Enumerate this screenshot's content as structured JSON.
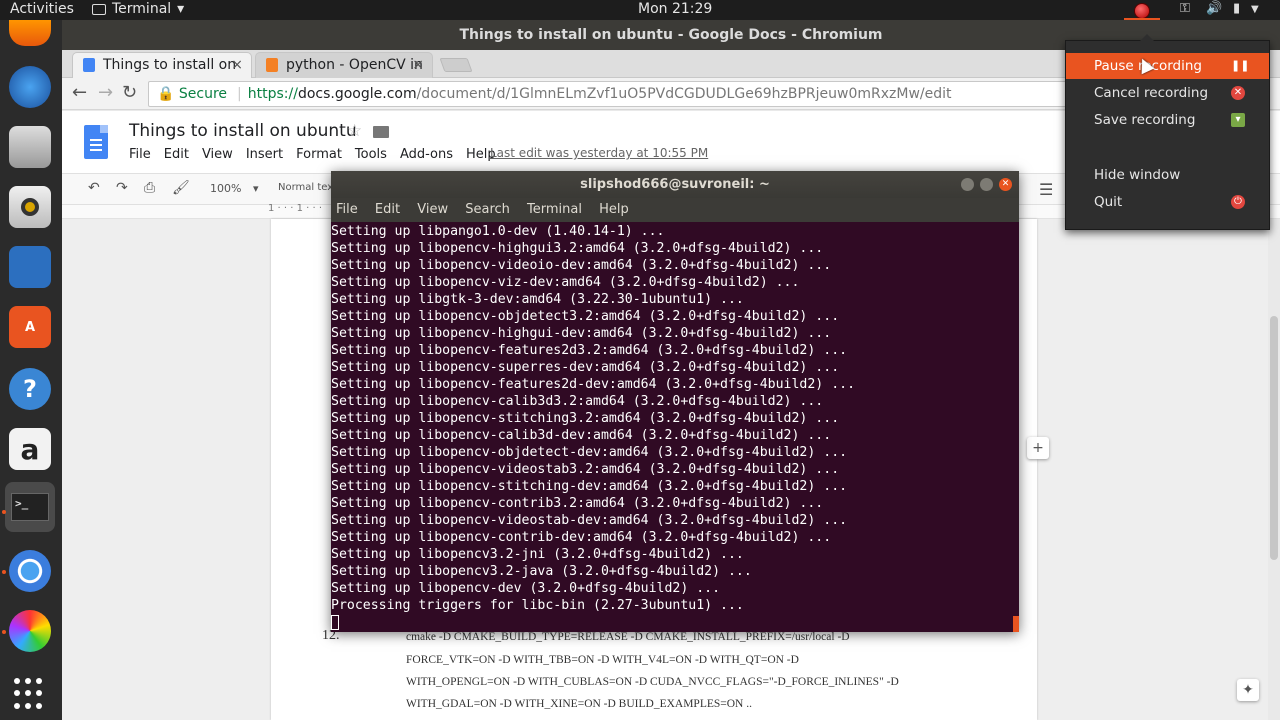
{
  "topbar": {
    "activities": "Activities",
    "app_name": "Terminal",
    "app_arrow": "▾",
    "clock": "Mon 21:29",
    "status_icons": [
      "recorder-icon",
      "network-icon",
      "volume-icon",
      "battery-icon",
      "power-menu-icon"
    ]
  },
  "window": {
    "title": "Things to install on ubuntu - Google Docs - Chromium"
  },
  "dock": {
    "items": [
      "firefox-icon",
      "thunderbird-icon",
      "files-icon",
      "rhythmbox-icon",
      "libreoffice-writer-icon",
      "software-center-icon",
      "help-icon",
      "amazon-icon",
      "terminal-icon",
      "chromium-icon",
      "color-app-icon"
    ],
    "show_apps": "show-applications-icon"
  },
  "browser": {
    "tabs": [
      {
        "title": "Things to install on",
        "close": "×",
        "favicon_color": "#4285f4"
      },
      {
        "title": "python - OpenCV in",
        "close": "×",
        "favicon_color": "#f48024"
      }
    ],
    "nav": {
      "back": "←",
      "forward": "→",
      "reload": "↻"
    },
    "omnibox": {
      "lock": "🔒",
      "secure": "Secure",
      "https": "https://",
      "host": "docs.google.com",
      "path": "/document/d/1GlmnELmZvf1uO5PVdCGDUDLGe69hzBPRjeuw0mRxzMw/edit"
    }
  },
  "docs": {
    "title": "Things to install on ubuntu",
    "star": "☆",
    "menus": [
      "File",
      "Edit",
      "View",
      "Insert",
      "Format",
      "Tools",
      "Add-ons",
      "Help"
    ],
    "last_edit": "Last edit was yesterday at 10:55 PM",
    "toolbar": {
      "undo": "↶",
      "redo": "↷",
      "print": "⎙",
      "paint": "🖌",
      "zoom": "100%",
      "zoom_arrow": "▾",
      "style": "Normal tex"
    },
    "ruler_mark": "1 · · · 1 · · ·",
    "list_number": "12.",
    "body_lines": [
      "cmake -D CMAKE_BUILD_TYPE=RELEASE -D CMAKE_INSTALL_PREFIX=/usr/local -D",
      "FORCE_VTK=ON -D WITH_TBB=ON -D WITH_V4L=ON -D WITH_QT=ON -D",
      "WITH_OPENGL=ON -D WITH_CUBLAS=ON -D CUDA_NVCC_FLAGS=\"-D_FORCE_INLINES\" -D",
      "WITH_GDAL=ON -D WITH_XINE=ON -D BUILD_EXAMPLES=ON .."
    ],
    "add_comment": "+",
    "explore": "✦"
  },
  "terminal": {
    "title": "slipshod666@suvroneil: ~",
    "close": "✕",
    "menu": [
      "File",
      "Edit",
      "View",
      "Search",
      "Terminal",
      "Help"
    ],
    "lines": [
      "Setting up libpango1.0-dev (1.40.14-1) ...",
      "Setting up libopencv-highgui3.2:amd64 (3.2.0+dfsg-4build2) ...",
      "Setting up libopencv-videoio-dev:amd64 (3.2.0+dfsg-4build2) ...",
      "Setting up libopencv-viz-dev:amd64 (3.2.0+dfsg-4build2) ...",
      "Setting up libgtk-3-dev:amd64 (3.22.30-1ubuntu1) ...",
      "Setting up libopencv-objdetect3.2:amd64 (3.2.0+dfsg-4build2) ...",
      "Setting up libopencv-highgui-dev:amd64 (3.2.0+dfsg-4build2) ...",
      "Setting up libopencv-features2d3.2:amd64 (3.2.0+dfsg-4build2) ...",
      "Setting up libopencv-superres-dev:amd64 (3.2.0+dfsg-4build2) ...",
      "Setting up libopencv-features2d-dev:amd64 (3.2.0+dfsg-4build2) ...",
      "Setting up libopencv-calib3d3.2:amd64 (3.2.0+dfsg-4build2) ...",
      "Setting up libopencv-stitching3.2:amd64 (3.2.0+dfsg-4build2) ...",
      "Setting up libopencv-calib3d-dev:amd64 (3.2.0+dfsg-4build2) ...",
      "Setting up libopencv-objdetect-dev:amd64 (3.2.0+dfsg-4build2) ...",
      "Setting up libopencv-videostab3.2:amd64 (3.2.0+dfsg-4build2) ...",
      "Setting up libopencv-stitching-dev:amd64 (3.2.0+dfsg-4build2) ...",
      "Setting up libopencv-contrib3.2:amd64 (3.2.0+dfsg-4build2) ...",
      "Setting up libopencv-videostab-dev:amd64 (3.2.0+dfsg-4build2) ...",
      "Setting up libopencv-contrib-dev:amd64 (3.2.0+dfsg-4build2) ...",
      "Setting up libopencv3.2-jni (3.2.0+dfsg-4build2) ...",
      "Setting up libopencv3.2-java (3.2.0+dfsg-4build2) ...",
      "Setting up libopencv-dev (3.2.0+dfsg-4build2) ...",
      "Processing triggers for libc-bin (2.27-3ubuntu1) ..."
    ]
  },
  "recorder_menu": {
    "items": [
      {
        "label": "Pause recording",
        "icon": "pause-icon",
        "glyph": "❚❚",
        "color": "#e95420"
      },
      {
        "label": "Cancel recording",
        "icon": "cancel-icon",
        "glyph": "✕",
        "color": "#e2473f"
      },
      {
        "label": "Save recording",
        "icon": "save-icon",
        "glyph": "▾",
        "color": "#7aa846"
      },
      {
        "label": "Hide window",
        "icon": "",
        "glyph": "",
        "color": ""
      },
      {
        "label": "Quit",
        "icon": "quit-icon",
        "glyph": "⏻",
        "color": "#e2473f"
      }
    ]
  },
  "colors": {
    "ubuntu_orange": "#e95420",
    "terminal_bg": "#300a24",
    "docs_blue": "#4285f4",
    "secure_green": "#0b8043"
  }
}
